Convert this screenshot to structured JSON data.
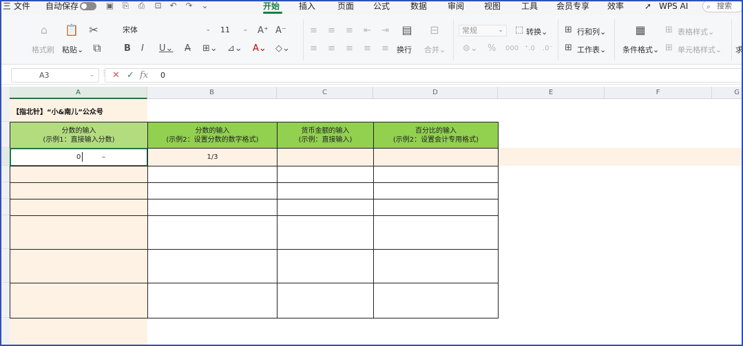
{
  "menu": {
    "app_menu": "三 文件",
    "autosave_label": "自动保存",
    "tabs": [
      "开始",
      "插入",
      "页面",
      "公式",
      "数据",
      "审阅",
      "视图",
      "工具",
      "会员专享",
      "效率"
    ],
    "wps_ai": "WPS AI",
    "search_placeholder": "搜索"
  },
  "ribbon": {
    "format_painter": "格式刷",
    "paste": "粘贴",
    "font_name": "宋体",
    "font_size": "11",
    "wrap_text": "换行",
    "merge": "合并",
    "number_format": "常规",
    "convert": "转换",
    "rows_cols": "行和列",
    "worksheet": "工作表",
    "conditional_format": "条件格式",
    "table_style": "表格样式",
    "cell_style": "单元格样式",
    "extra": "求"
  },
  "formula_bar": {
    "cell_ref": "A3",
    "value": "0",
    "fx_label": "fx"
  },
  "sheet": {
    "columns": [
      "A",
      "B",
      "C",
      "D",
      "E",
      "F",
      "G"
    ],
    "selected_column": "A",
    "note": "【指北针】“小&南儿”公众号",
    "headers": [
      {
        "title": "分数的输入",
        "subtitle": "(示例1：直接输入分数)"
      },
      {
        "title": "分数的输入",
        "subtitle": "(示例2：设置分数的数字格式)"
      },
      {
        "title": "货币金额的输入",
        "subtitle": "(示例：直接输入)"
      },
      {
        "title": "百分比的输入",
        "subtitle": "(示例2：设置会计专用格式)"
      }
    ],
    "row3": {
      "a": "0",
      "a_extra": "–",
      "b": "1/3"
    }
  },
  "colors": {
    "accent": "#1a7d45",
    "header_green_light": "#b3dc7f",
    "header_green": "#92d050",
    "col_a_fill": "#fdf2e3",
    "row_highlight": "#fdf2e3",
    "frame": "#2f4fb8"
  }
}
